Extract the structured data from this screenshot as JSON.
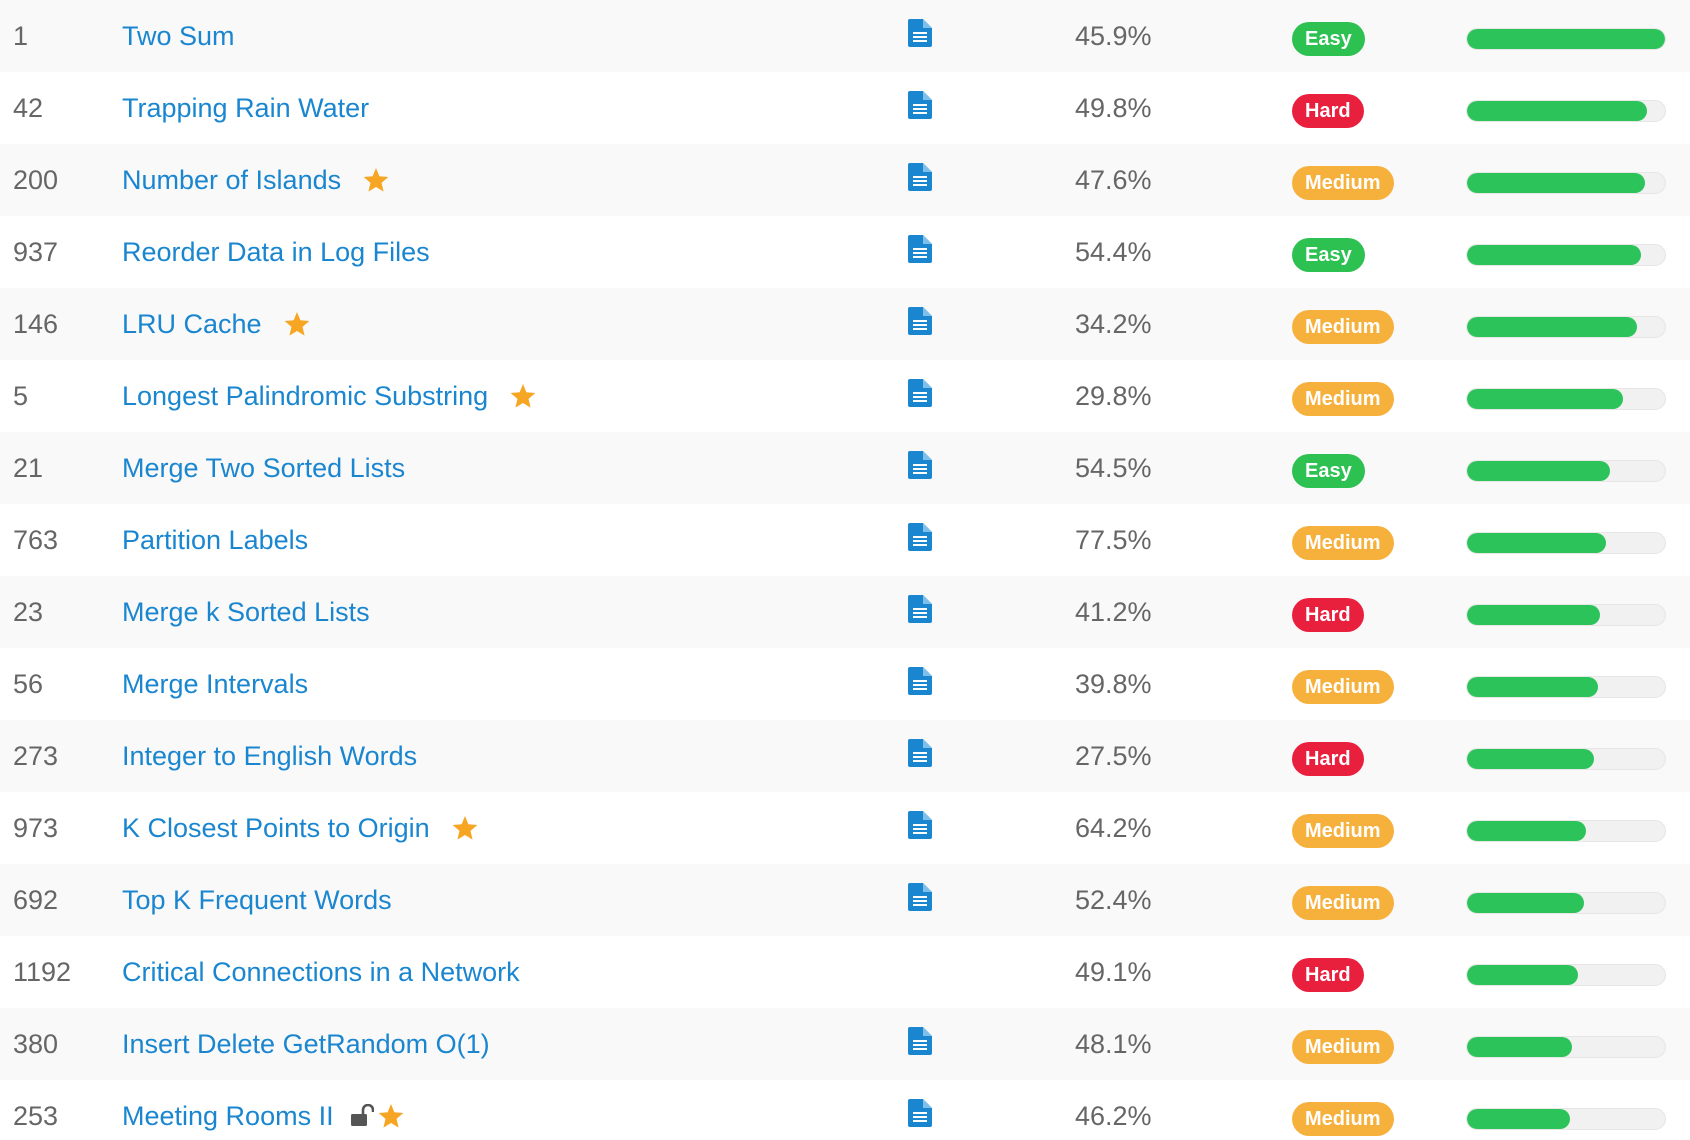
{
  "colors": {
    "link": "#1a86d0",
    "muted_text": "#666666",
    "easy": "#2cc151",
    "medium": "#f6b03c",
    "hard": "#e9203d",
    "frequency_fill": "#2cc45a",
    "star": "#f6a623",
    "solution_icon": "#1a86d0"
  },
  "problems": [
    {
      "id": "1",
      "title": "Two Sum",
      "starred": false,
      "locked": false,
      "has_solution": true,
      "acceptance": "45.9%",
      "difficulty": "Easy",
      "frequency": 1.0
    },
    {
      "id": "42",
      "title": "Trapping Rain Water",
      "starred": false,
      "locked": false,
      "has_solution": true,
      "acceptance": "49.8%",
      "difficulty": "Hard",
      "frequency": 0.91
    },
    {
      "id": "200",
      "title": "Number of Islands",
      "starred": true,
      "locked": false,
      "has_solution": true,
      "acceptance": "47.6%",
      "difficulty": "Medium",
      "frequency": 0.9
    },
    {
      "id": "937",
      "title": "Reorder Data in Log Files",
      "starred": false,
      "locked": false,
      "has_solution": true,
      "acceptance": "54.4%",
      "difficulty": "Easy",
      "frequency": 0.88
    },
    {
      "id": "146",
      "title": "LRU Cache",
      "starred": true,
      "locked": false,
      "has_solution": true,
      "acceptance": "34.2%",
      "difficulty": "Medium",
      "frequency": 0.86
    },
    {
      "id": "5",
      "title": "Longest Palindromic Substring",
      "starred": true,
      "locked": false,
      "has_solution": true,
      "acceptance": "29.8%",
      "difficulty": "Medium",
      "frequency": 0.79
    },
    {
      "id": "21",
      "title": "Merge Two Sorted Lists",
      "starred": false,
      "locked": false,
      "has_solution": true,
      "acceptance": "54.5%",
      "difficulty": "Easy",
      "frequency": 0.72
    },
    {
      "id": "763",
      "title": "Partition Labels",
      "starred": false,
      "locked": false,
      "has_solution": true,
      "acceptance": "77.5%",
      "difficulty": "Medium",
      "frequency": 0.7
    },
    {
      "id": "23",
      "title": "Merge k Sorted Lists",
      "starred": false,
      "locked": false,
      "has_solution": true,
      "acceptance": "41.2%",
      "difficulty": "Hard",
      "frequency": 0.67
    },
    {
      "id": "56",
      "title": "Merge Intervals",
      "starred": false,
      "locked": false,
      "has_solution": true,
      "acceptance": "39.8%",
      "difficulty": "Medium",
      "frequency": 0.66
    },
    {
      "id": "273",
      "title": "Integer to English Words",
      "starred": false,
      "locked": false,
      "has_solution": true,
      "acceptance": "27.5%",
      "difficulty": "Hard",
      "frequency": 0.64
    },
    {
      "id": "973",
      "title": "K Closest Points to Origin",
      "starred": true,
      "locked": false,
      "has_solution": true,
      "acceptance": "64.2%",
      "difficulty": "Medium",
      "frequency": 0.6
    },
    {
      "id": "692",
      "title": "Top K Frequent Words",
      "starred": false,
      "locked": false,
      "has_solution": true,
      "acceptance": "52.4%",
      "difficulty": "Medium",
      "frequency": 0.59
    },
    {
      "id": "1192",
      "title": "Critical Connections in a Network",
      "starred": false,
      "locked": false,
      "has_solution": false,
      "acceptance": "49.1%",
      "difficulty": "Hard",
      "frequency": 0.56
    },
    {
      "id": "380",
      "title": "Insert Delete GetRandom O(1)",
      "starred": false,
      "locked": false,
      "has_solution": true,
      "acceptance": "48.1%",
      "difficulty": "Medium",
      "frequency": 0.53
    },
    {
      "id": "253",
      "title": "Meeting Rooms II",
      "starred": true,
      "locked": true,
      "has_solution": true,
      "acceptance": "46.2%",
      "difficulty": "Medium",
      "frequency": 0.52
    }
  ]
}
